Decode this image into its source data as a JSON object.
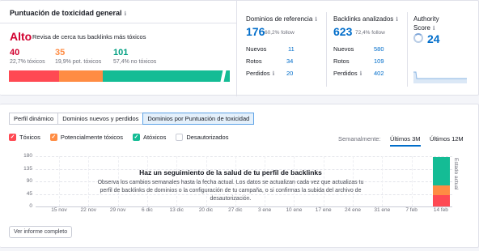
{
  "toxicity": {
    "title": "Puntuación de toxicidad general",
    "info_icon": "info-icon",
    "level": "Alto",
    "level_desc": "Revisa de cerca tus backlinks más tóxicos",
    "stats": [
      {
        "value": "40",
        "label": "22,7% tóxicos",
        "color": "#d1002f"
      },
      {
        "value": "35",
        "label": "19,9% pot. tóxicos",
        "color": "#ff8c43"
      },
      {
        "value": "101",
        "label": "57,4% no tóxicos",
        "color": "#009f81"
      }
    ],
    "bar_colors": {
      "toxic": "#ff4953",
      "potential": "#ff8c43",
      "non_toxic": "#14bc95"
    }
  },
  "referring_domains": {
    "label": "Dominios de referencia",
    "value": "176",
    "pct": "60,2% follow",
    "rows": [
      {
        "label": "Nuevos",
        "value": "11"
      },
      {
        "label": "Rotos",
        "value": "34"
      },
      {
        "label": "Perdidos",
        "value": "20"
      }
    ]
  },
  "backlinks": {
    "label": "Backlinks analizados",
    "value": "623",
    "pct": "72,4% follow",
    "rows": [
      {
        "label": "Nuevos",
        "value": "580"
      },
      {
        "label": "Rotos",
        "value": "109"
      },
      {
        "label": "Perdidos",
        "value": "402"
      }
    ]
  },
  "authority": {
    "label_line1": "Authority",
    "label_line2": "Score",
    "value": "24"
  },
  "tabs": [
    "Perfil dinámico",
    "Dominios nuevos y perdidos",
    "Dominios por Puntuación de toxicidad"
  ],
  "legend": [
    {
      "label": "Tóxicos",
      "color": "#ff4953",
      "checked": true
    },
    {
      "label": "Potencialmente tóxicos",
      "color": "#ff8c43",
      "checked": true
    },
    {
      "label": "Atóxicos",
      "color": "#14bc95",
      "checked": true
    },
    {
      "label": "Desautorizados",
      "color": "#ffffff",
      "checked": false
    }
  ],
  "period": {
    "label": "Semanalmente:",
    "opt_3m": "Últimos 3M",
    "opt_12m": "Últimos 12M"
  },
  "chart_data": {
    "type": "bar",
    "categories": [
      "15 nov",
      "22 nov",
      "29 nov",
      "6 dic",
      "13 dic",
      "20 dic",
      "27 dic",
      "3 ene",
      "10 ene",
      "17 ene",
      "24 ene",
      "31 ene",
      "7 feb",
      "14 feb"
    ],
    "series": [
      {
        "name": "Tóxicos",
        "values": [
          0,
          0,
          0,
          0,
          0,
          0,
          0,
          0,
          0,
          0,
          0,
          0,
          0,
          40
        ]
      },
      {
        "name": "Potencialmente tóxicos",
        "values": [
          0,
          0,
          0,
          0,
          0,
          0,
          0,
          0,
          0,
          0,
          0,
          0,
          0,
          35
        ]
      },
      {
        "name": "Atóxicos",
        "values": [
          0,
          0,
          0,
          0,
          0,
          0,
          0,
          0,
          0,
          0,
          0,
          0,
          0,
          101
        ]
      }
    ],
    "yticks": [
      "180",
      "135",
      "90",
      "45",
      "0"
    ],
    "ylim": [
      0,
      180
    ],
    "vertical_label": "Estado actual"
  },
  "overlay": {
    "title": "Haz un seguimiento de la salud de tu perfil de backlinks",
    "desc": "Observa los cambios semanales hasta la fecha actual. Los datos se actualizan cada vez que actualizas tu perfil de backlinks de dominios o la configuración de tu campaña, o si confirmas la subida del archivo de desautorización."
  },
  "report_button": "Ver informe completo"
}
